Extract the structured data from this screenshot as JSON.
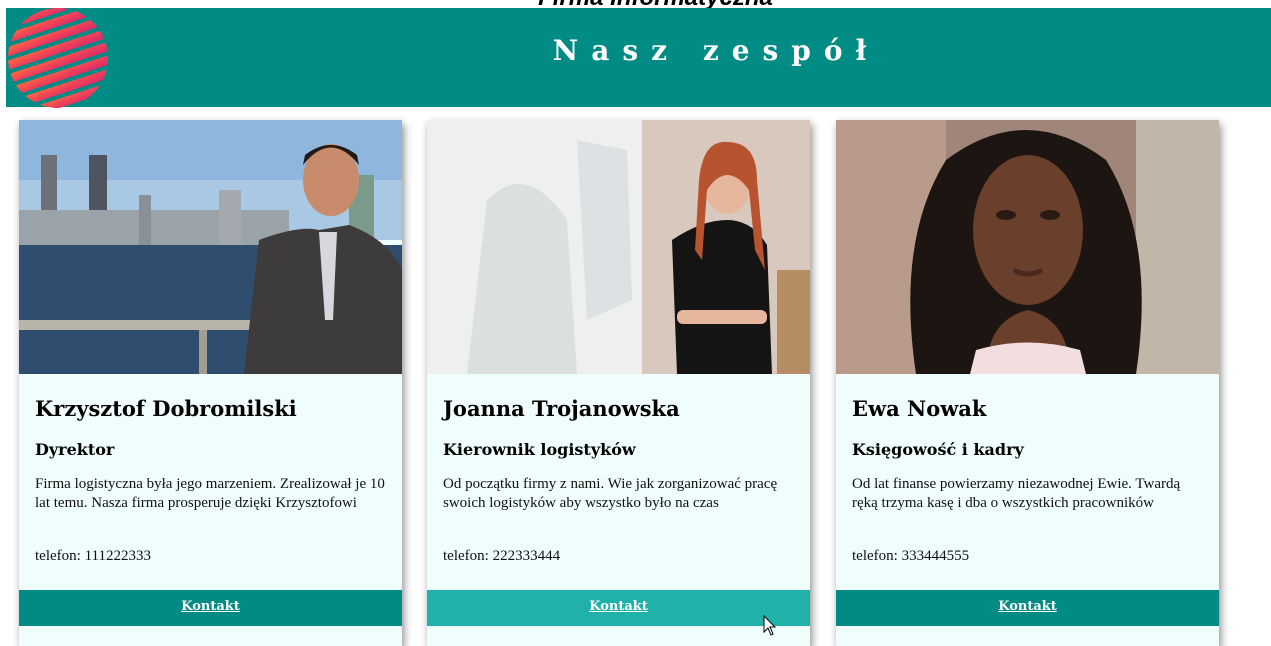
{
  "page": {
    "top_heading_partial": "Firma Informatyczna",
    "header_title": "Nasz zespół"
  },
  "colors": {
    "header_bg": "#008b85",
    "card_bg": "#f0fdfd",
    "button_bg": "#008b85",
    "button_hover_bg": "#20b2aa"
  },
  "team": [
    {
      "name": "Krzysztof Dobromilski",
      "role": "Dyrektor",
      "description": "Firma logistyczna była jego marzeniem. Zrealizował je 10 lat temu. Nasza firma prosperuje dzięki Krzysztofowi",
      "phone": "telefon: 111222333",
      "button_label": "Kontakt"
    },
    {
      "name": "Joanna Trojanowska",
      "role": "Kierownik logistyków",
      "description": "Od początku firmy z nami. Wie jak zorganizować pracę swoich logistyków aby wszystko było na czas",
      "phone": "telefon: 222333444",
      "button_label": "Kontakt"
    },
    {
      "name": "Ewa Nowak",
      "role": "Księgowość i kadry",
      "description": "Od lat finanse powierzamy niezawodnej Ewie. Twardą ręką trzyma kasę i dba o wszystkich pracowników",
      "phone": "telefon: 333444555",
      "button_label": "Kontakt"
    }
  ],
  "icons": {
    "logo": "striped-globe-logo",
    "cursor": "mouse-pointer-icon"
  }
}
